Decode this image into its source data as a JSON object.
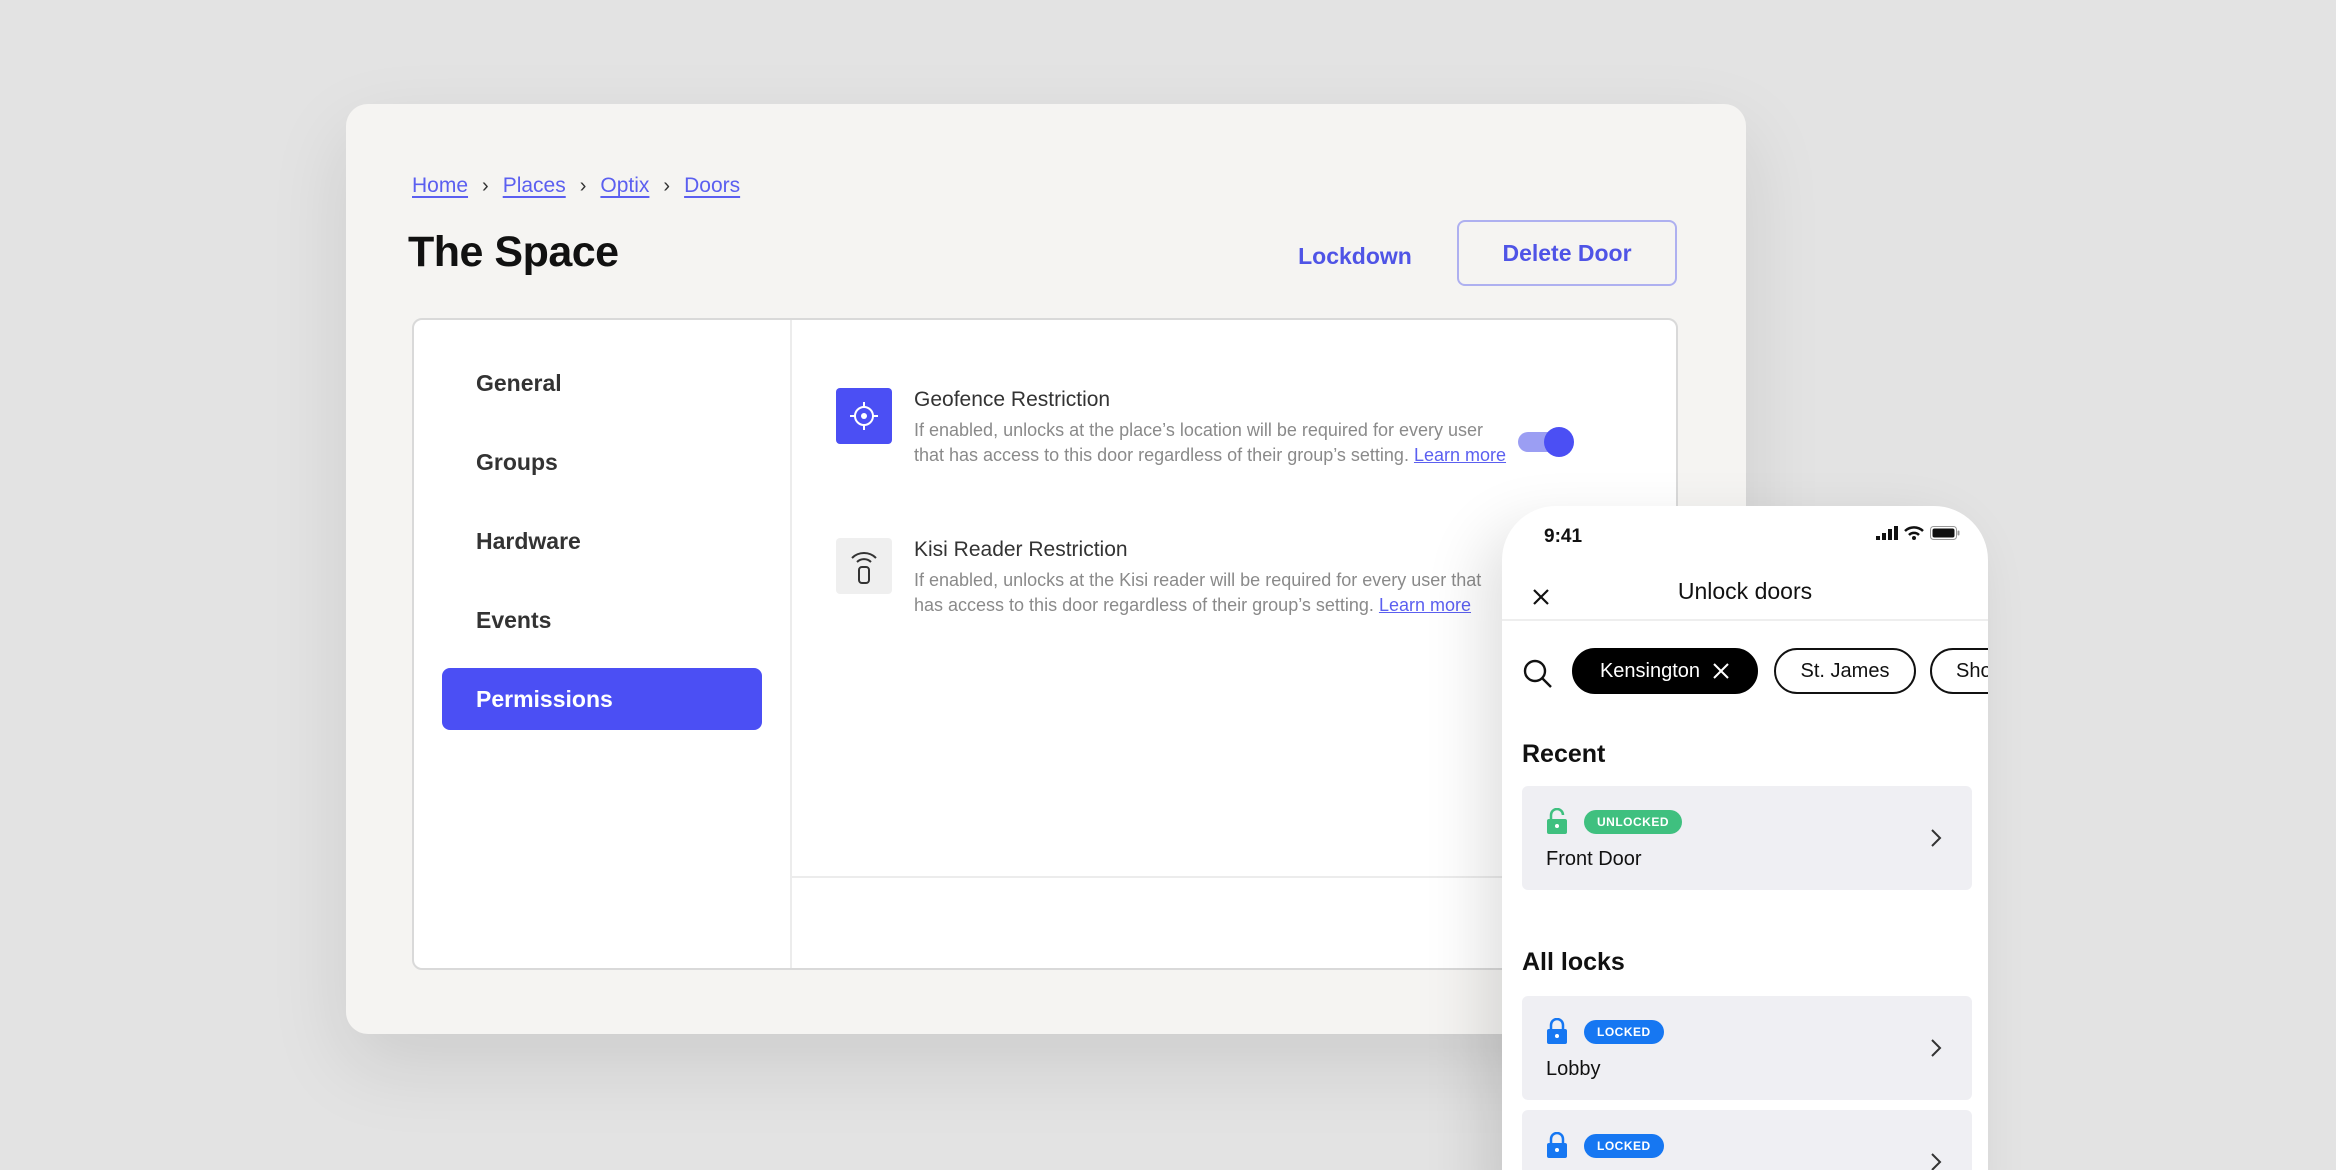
{
  "desktop": {
    "breadcrumb": [
      "Home",
      "Places",
      "Optix",
      "Doors"
    ],
    "breadcrumb_separator": "›",
    "title": "The Space",
    "actions": {
      "lockdown": "Lockdown",
      "delete": "Delete Door"
    },
    "nav": [
      "General",
      "Groups",
      "Hardware",
      "Events",
      "Permissions"
    ],
    "active_nav": "Permissions",
    "permissions": [
      {
        "icon": "geofence-target-icon",
        "title": "Geofence Restriction",
        "description": "If enabled, unlocks at the place’s location will be required for every user that has access to this door regardless of their group’s setting.",
        "link": "Learn more",
        "toggle_on": true
      },
      {
        "icon": "reader-signal-icon",
        "title": "Kisi Reader Restriction",
        "description": "If enabled, unlocks at the Kisi reader will be required for every user that has access to this door regardless of their group’s setting.",
        "link": "Learn more"
      }
    ],
    "accent_color": "#4b4ff4"
  },
  "phone": {
    "time": "9:41",
    "title": "Unlock doors",
    "chips": [
      "Kensington",
      "St. James",
      "Sho"
    ],
    "active_chip": "Kensington",
    "recent_label": "Recent",
    "recent": [
      {
        "status": "UNLOCKED",
        "name": "Front Door"
      }
    ],
    "all_label": "All locks",
    "all": [
      {
        "status": "LOCKED",
        "name": "Lobby"
      },
      {
        "status": "LOCKED",
        "name": ""
      }
    ],
    "colors": {
      "unlocked": "#3fc07f",
      "locked": "#1677f2"
    }
  }
}
